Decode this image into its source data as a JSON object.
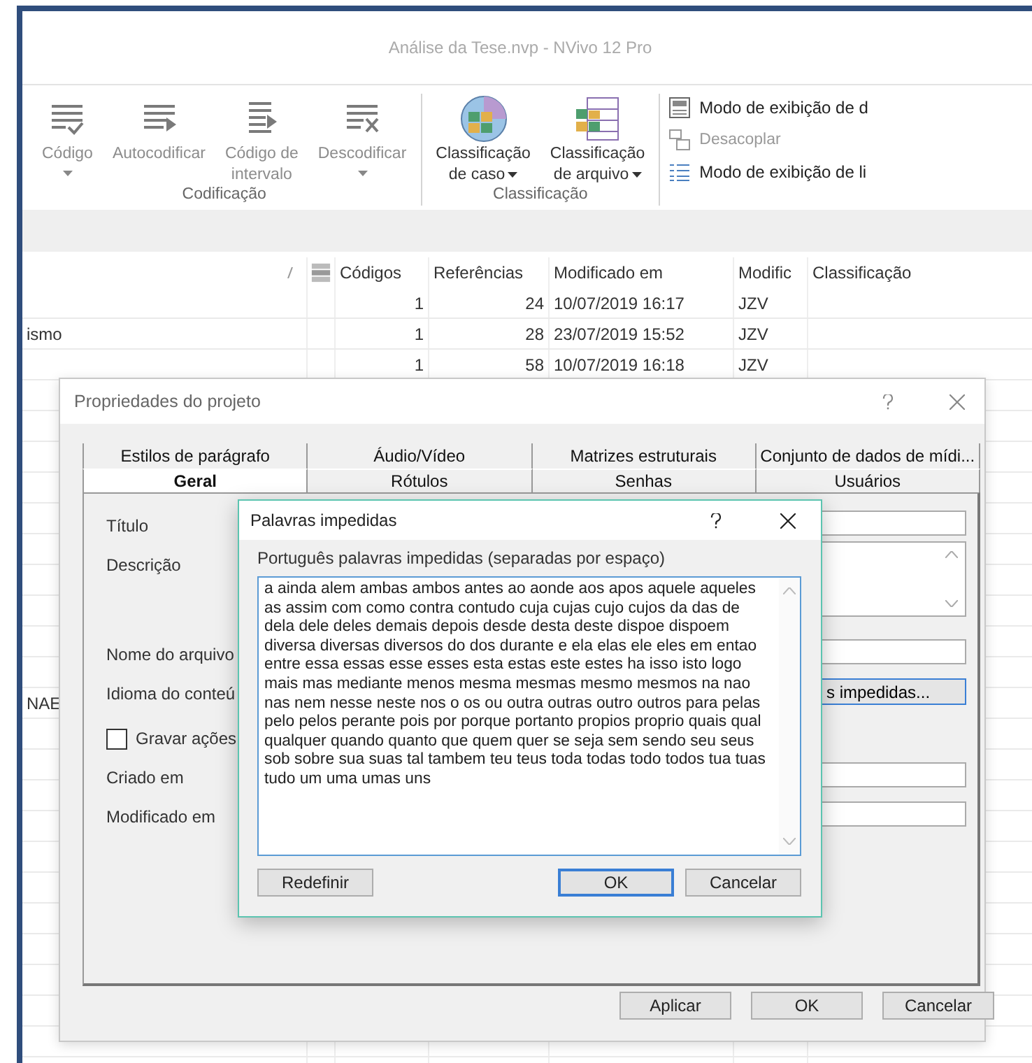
{
  "window": {
    "title": "Análise da Tese.nvp - NVivo 12 Pro"
  },
  "ribbon": {
    "groups": [
      {
        "label": "Codificação",
        "buttons": [
          {
            "label": "Código",
            "kind": "code",
            "dropdown": true,
            "disabled": true
          },
          {
            "label": "Autocodificar",
            "kind": "autocode",
            "dropdown": false,
            "disabled": true
          },
          {
            "label": "Código de\nintervalo",
            "kind": "range",
            "dropdown": false,
            "disabled": true
          },
          {
            "label": "Descodificar",
            "kind": "uncode",
            "dropdown": true,
            "disabled": true
          }
        ]
      },
      {
        "label": "Classificação",
        "buttons": [
          {
            "label": "Classificação\nde caso",
            "kind": "case",
            "dropdown": true,
            "disabled": false
          },
          {
            "label": "Classificação\nde arquivo",
            "kind": "file",
            "dropdown": true,
            "disabled": false
          }
        ]
      }
    ],
    "items": [
      {
        "label": "Modo de exibição de d",
        "kind": "detail",
        "disabled": false
      },
      {
        "label": "Desacoplar",
        "kind": "undock",
        "disabled": true
      },
      {
        "label": "Modo de exibição de li",
        "kind": "list",
        "disabled": false
      }
    ]
  },
  "table": {
    "columns": [
      "Códigos",
      "Referências",
      "Modificado em",
      "Modific",
      "Classificação"
    ],
    "rows": [
      {
        "codes": "1",
        "references": "24",
        "modified": "10/07/2019 16:17",
        "by": "JZV"
      },
      {
        "name": "ismo",
        "codes": "1",
        "references": "28",
        "modified": "23/07/2019 15:52",
        "by": "JZV"
      },
      {
        "codes": "1",
        "references": "58",
        "modified": "10/07/2019 16:18",
        "by": "JZV"
      },
      {},
      {},
      {},
      {},
      {},
      {},
      {},
      {},
      {},
      {},
      {
        "name": "NAE"
      },
      {},
      {},
      {},
      {},
      {},
      {},
      {},
      {},
      {},
      {},
      {},
      {}
    ]
  },
  "properties_dialog": {
    "title": "Propriedades do projeto",
    "tabs_back": [
      {
        "label": "Estilos de parágrafo",
        "selected": false
      },
      {
        "label": "Áudio/Vídeo",
        "selected": false
      },
      {
        "label": "Matrizes estruturais",
        "selected": false
      },
      {
        "label": "Conjunto de dados de mídi...",
        "selected": false
      }
    ],
    "tabs_front": [
      {
        "label": "Geral",
        "selected": true
      },
      {
        "label": "Rótulos",
        "selected": false
      },
      {
        "label": "Senhas",
        "selected": false
      },
      {
        "label": "Usuários",
        "selected": false
      }
    ],
    "fields": [
      {
        "kind": "input",
        "label": "Título"
      },
      {
        "kind": "textarea",
        "label": "Descrição"
      },
      {
        "kind": "input",
        "label": "Nome do arquivo"
      },
      {
        "kind": "button",
        "label": "Idioma do conteú",
        "button": "s impedidas..."
      },
      {
        "kind": "checkbox",
        "label": "Gravar ações",
        "checked": false
      },
      {
        "kind": "input",
        "label": "Criado em"
      },
      {
        "kind": "input",
        "label": "Modificado em"
      }
    ],
    "buttons": [
      "Aplicar",
      "OK",
      "Cancelar"
    ]
  },
  "stopwords_dialog": {
    "title": "Palavras impedidas",
    "label": "Português palavras impedidas (separadas por espaço)",
    "value": "a ainda alem ambas ambos antes ao aonde aos apos aquele aqueles as assim com como contra contudo cuja cujas cujo cujos da das de dela dele deles demais depois desde desta deste dispoe dispoem diversa diversas diversos do dos durante e ela elas ele eles em entao entre essa essas esse esses esta estas este estes ha isso isto logo mais mas mediante menos mesma mesmas mesmo mesmos na nao nas nem nesse neste nos o os ou outra outras outro outros para pelas pelo pelos perante pois por porque portanto propios proprio quais qual qualquer quando quanto que quem quer se seja sem sendo seu seus sob sobre sua suas tal tambem teu teus toda todas todo todos tua tuas tudo um uma umas uns ",
    "buttons": [
      {
        "label": "Redefinir",
        "default": false
      },
      {
        "label": "OK",
        "default": true
      },
      {
        "label": "Cancelar",
        "default": false
      }
    ]
  }
}
